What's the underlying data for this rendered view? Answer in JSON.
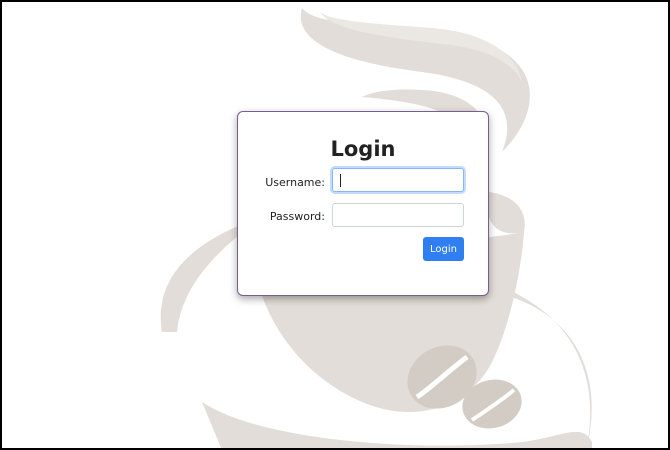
{
  "login": {
    "title": "Login",
    "username_label": "Username:",
    "password_label": "Password:",
    "username_value": "",
    "password_value": "",
    "button_label": "Login"
  },
  "colors": {
    "accent": "#2f7ff3",
    "card_border": "#7b5c8e",
    "background_art": "#e2ddd8",
    "focus_ring": "#86b7fe"
  },
  "icons": {
    "background": "coffee-cup-illustration"
  }
}
